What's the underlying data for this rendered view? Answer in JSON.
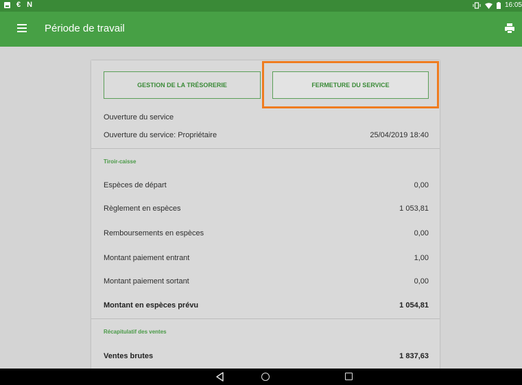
{
  "status_bar": {
    "left_icons": [
      "image-icon",
      "euro-icon",
      "n-icon"
    ],
    "euro_glyph": "€",
    "n_glyph": "N",
    "time": "16:05"
  },
  "appbar": {
    "title": "Période de travail"
  },
  "buttons": {
    "gestion": "GESTION DE LA TRÉSORERIE",
    "fermeture": "FERMETURE DU SERVICE"
  },
  "opening": {
    "title": "Ouverture du service",
    "owner_label": "Ouverture du service: Propriétaire",
    "owner_date": "25/04/2019 18:40"
  },
  "cash_drawer": {
    "header": "Tiroir-caisse",
    "rows": [
      {
        "label": "Espèces de départ",
        "value": "0,00"
      },
      {
        "label": "Règlement en espèces",
        "value": "1 053,81"
      },
      {
        "label": "Remboursements en espèces",
        "value": "0,00"
      },
      {
        "label": "Montant paiement entrant",
        "value": "1,00"
      },
      {
        "label": "Montant paiement sortant",
        "value": "0,00"
      }
    ],
    "total": {
      "label": "Montant en espèces prévu",
      "value": "1 054,81"
    }
  },
  "sales_summary": {
    "header": "Récapitulatif des ventes",
    "gross": {
      "label": "Ventes brutes",
      "value": "1 837,63"
    }
  },
  "colors": {
    "appbar": "#47a045",
    "statusbar": "#3a8a37",
    "highlight": "#ef7c1f",
    "accent_text": "#4a9a47"
  }
}
